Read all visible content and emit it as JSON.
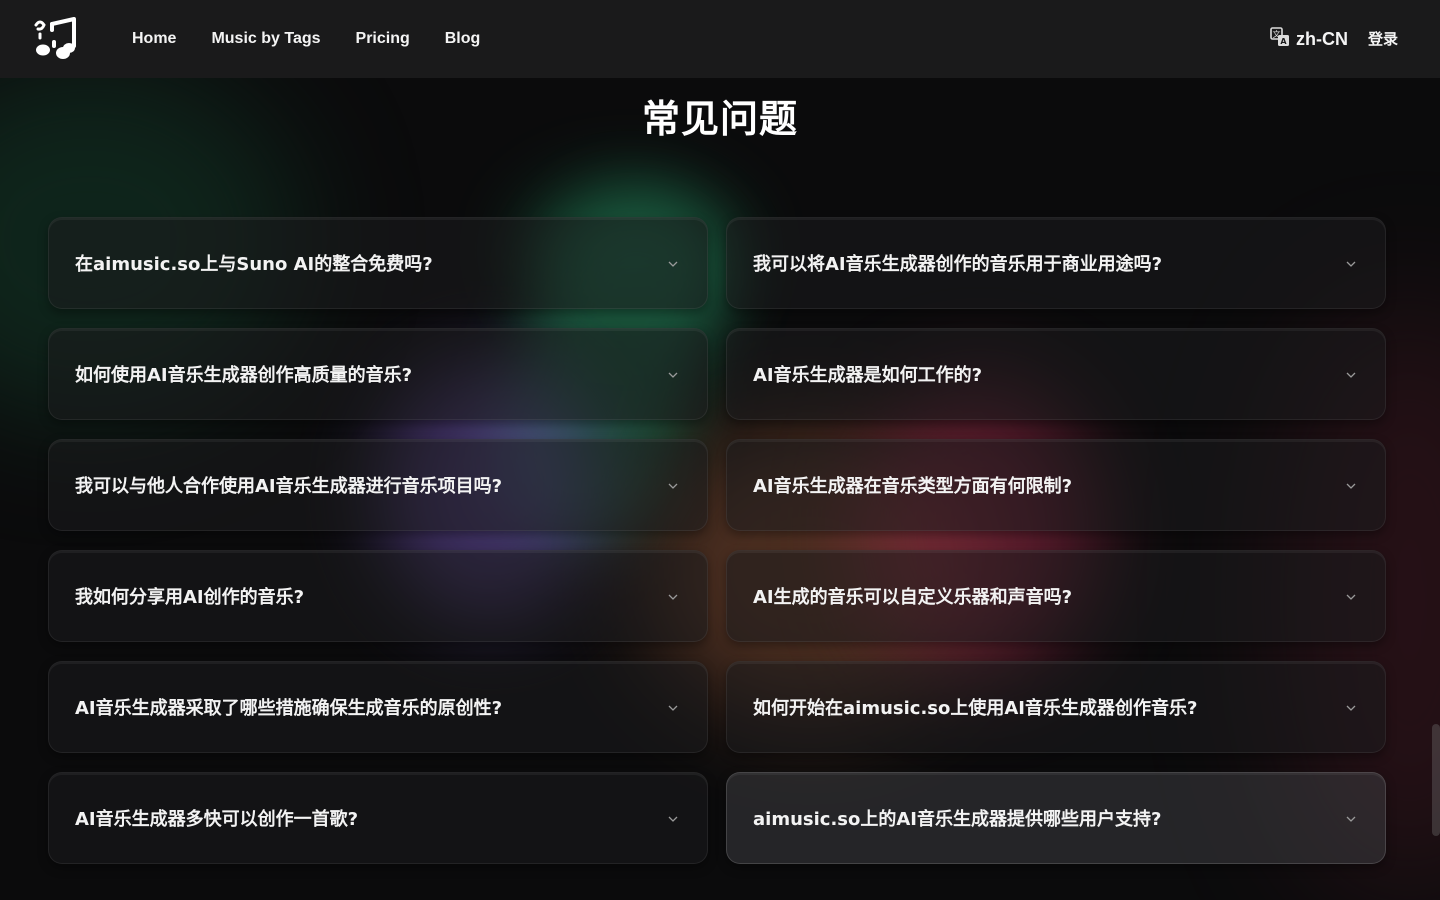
{
  "nav": {
    "links": [
      "Home",
      "Music by Tags",
      "Pricing",
      "Blog"
    ],
    "language": "zh-CN",
    "login_label": "登录",
    "logo_icon": "music-note-logo-icon",
    "language_icon": "translate-icon"
  },
  "page": {
    "title": "常见问题"
  },
  "faq": {
    "items": [
      "在aimusic.so上与Suno AI的整合免费吗?",
      "我可以将AI音乐生成器创作的音乐用于商业用途吗?",
      "如何使用AI音乐生成器创作高质量的音乐?",
      "AI音乐生成器是如何工作的?",
      "我可以与他人合作使用AI音乐生成器进行音乐项目吗?",
      "AI音乐生成器在音乐类型方面有何限制?",
      "我如何分享用AI创作的音乐?",
      "AI生成的音乐可以自定义乐器和声音吗?",
      "AI音乐生成器采取了哪些措施确保生成音乐的原创性?",
      "如何开始在aimusic.so上使用AI音乐生成器创作音乐?",
      "AI音乐生成器多快可以创作一首歌?",
      "aimusic.so上的AI音乐生成器提供哪些用户支持?"
    ],
    "expand_icon": "chevron-down-icon"
  },
  "colors": {
    "background": "#0b0b0c",
    "navbar": "#1a1a1b",
    "text": "#f3f3f3"
  }
}
